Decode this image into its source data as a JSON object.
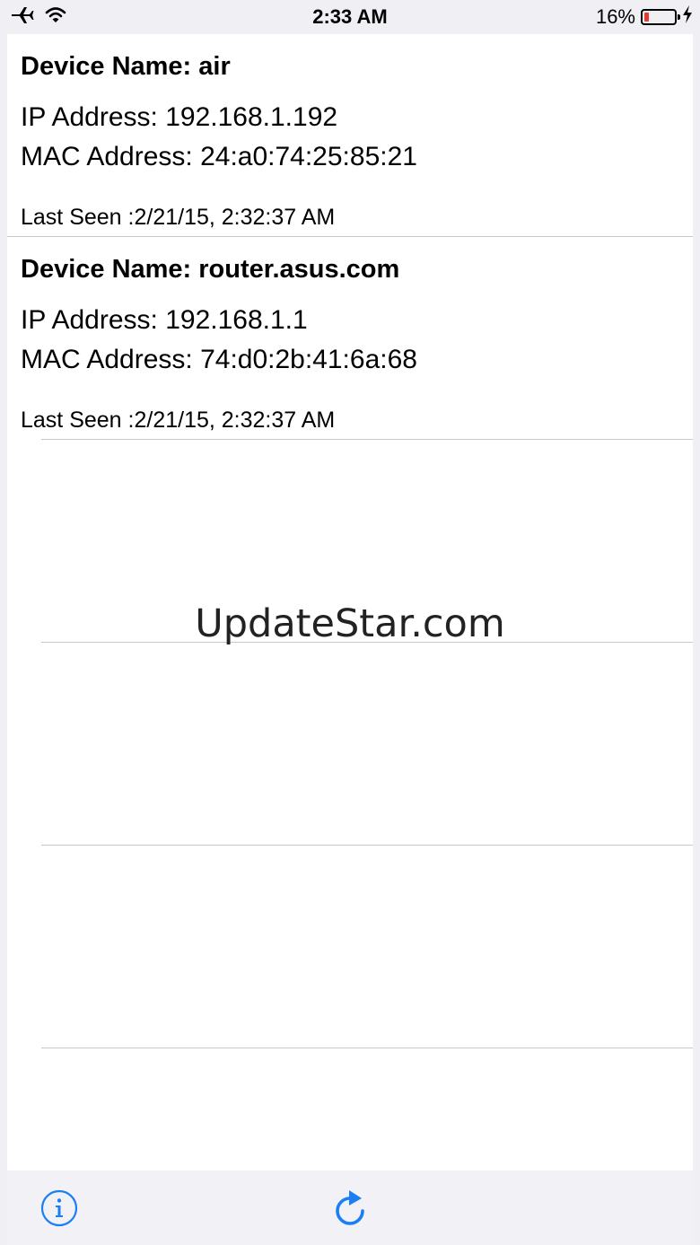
{
  "status_bar": {
    "time": "2:33 AM",
    "battery_percent": "16%",
    "battery_level": 0.16,
    "icons": [
      "airplane-icon",
      "wifi-icon",
      "battery-icon",
      "charging-icon"
    ]
  },
  "devices": [
    {
      "name": "Device Name: air",
      "ip": "IP Address: 192.168.1.192",
      "mac": "MAC Address: 24:a0:74:25:85:21",
      "last_seen": "Last Seen :2/21/15, 2:32:37 AM"
    },
    {
      "name": "Device Name: router.asus.com",
      "ip": "IP Address: 192.168.1.1",
      "mac": "MAC Address: 74:d0:2b:41:6a:68",
      "last_seen": "Last Seen :2/21/15, 2:32:37 AM"
    }
  ],
  "watermark": "UpdateStar.com",
  "toolbar": {
    "icons": [
      "info-icon",
      "refresh-icon"
    ]
  },
  "colors": {
    "accent": "#1a7ef5",
    "battery_low": "#e53a2c",
    "separator": "#c8c7cc"
  }
}
